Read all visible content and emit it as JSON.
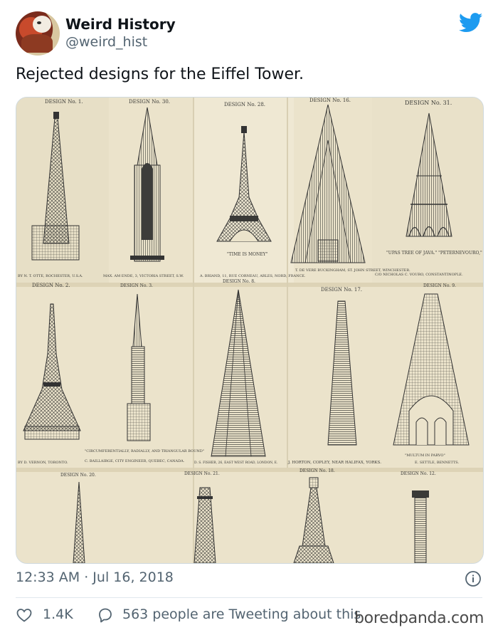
{
  "author": {
    "name": "Weird History",
    "handle": "@weird_hist"
  },
  "tweet": {
    "text": "Rejected designs for the Eiffel Tower.",
    "timestamp": "12:33 AM · Jul 16, 2018"
  },
  "stats": {
    "likes": "1.4K",
    "tweeting": "563 people are Tweeting about this"
  },
  "watermark": "boredpanda.com",
  "colors": {
    "twitter_blue": "#1d9bf0",
    "paper": "#ebe3cb",
    "ink": "#3a3a38",
    "muted": "#536471"
  },
  "media": {
    "rows": [
      {
        "designs": [
          {
            "number": "DESIGN No. 1.",
            "caption": "",
            "author": "BY N. T. OTTE, ROCHESTER, U.S.A."
          },
          {
            "number": "DESIGN No. 30.",
            "caption": "",
            "author": "MAX. AM ENDE, 3, VICTORIA STREET, S.W."
          },
          {
            "number": "DESIGN No. 28.",
            "caption": "\"TIME IS MONEY\"",
            "author": "A. BRIAND, 11, RUE CORNEAU, ARLES, NORD, FRANCE."
          },
          {
            "number": "DESIGN No. 16.",
            "caption": "",
            "author": "T. DE VERE BUCKINGHAM, ST. JOHN STREET, WINCHESTER."
          },
          {
            "number": "DESIGN No. 31.",
            "caption": "\"UPAS TREE OF JAVA.\" \"PETERNEVOURO,\"",
            "author": "C/O NICHOLAS C. VOURO, CONSTANTINOPLE."
          }
        ]
      },
      {
        "designs": [
          {
            "number": "DESIGN No. 2.",
            "caption": "",
            "author": "BY D. VERNON, TORONTO."
          },
          {
            "number": "DESIGN No. 3.",
            "caption": "\"CIRCUMFERENTIALLY, RADIALLY, AND TRIANGULAR BOUND\"",
            "author": "C. BAILLAIRGE, CITY ENGINEER, QUEBEC, CANADA."
          },
          {
            "number": "DESIGN No. 8.",
            "caption": "",
            "author": "D. S. FISHER, 26, EAST WEST ROAD, LONDON, E."
          },
          {
            "number": "DESIGN No. 17.",
            "caption": "",
            "author": "J. HORTON, COPLEY, NEAR HALIFAX, YORKS."
          },
          {
            "number": "DESIGN No. 9.",
            "caption": "\"MULTUM IN PARVO\"",
            "author": "E. SETTLE, BENNETTS."
          }
        ]
      },
      {
        "designs": [
          {
            "number": "DESIGN No. 20.",
            "caption": "",
            "author": ""
          },
          {
            "number": "DESIGN No. 21.",
            "caption": "",
            "author": ""
          },
          {
            "number": "DESIGN No. 18.",
            "caption": "",
            "author": ""
          },
          {
            "number": "DESIGN No. 12.",
            "caption": "",
            "author": ""
          }
        ]
      }
    ]
  }
}
